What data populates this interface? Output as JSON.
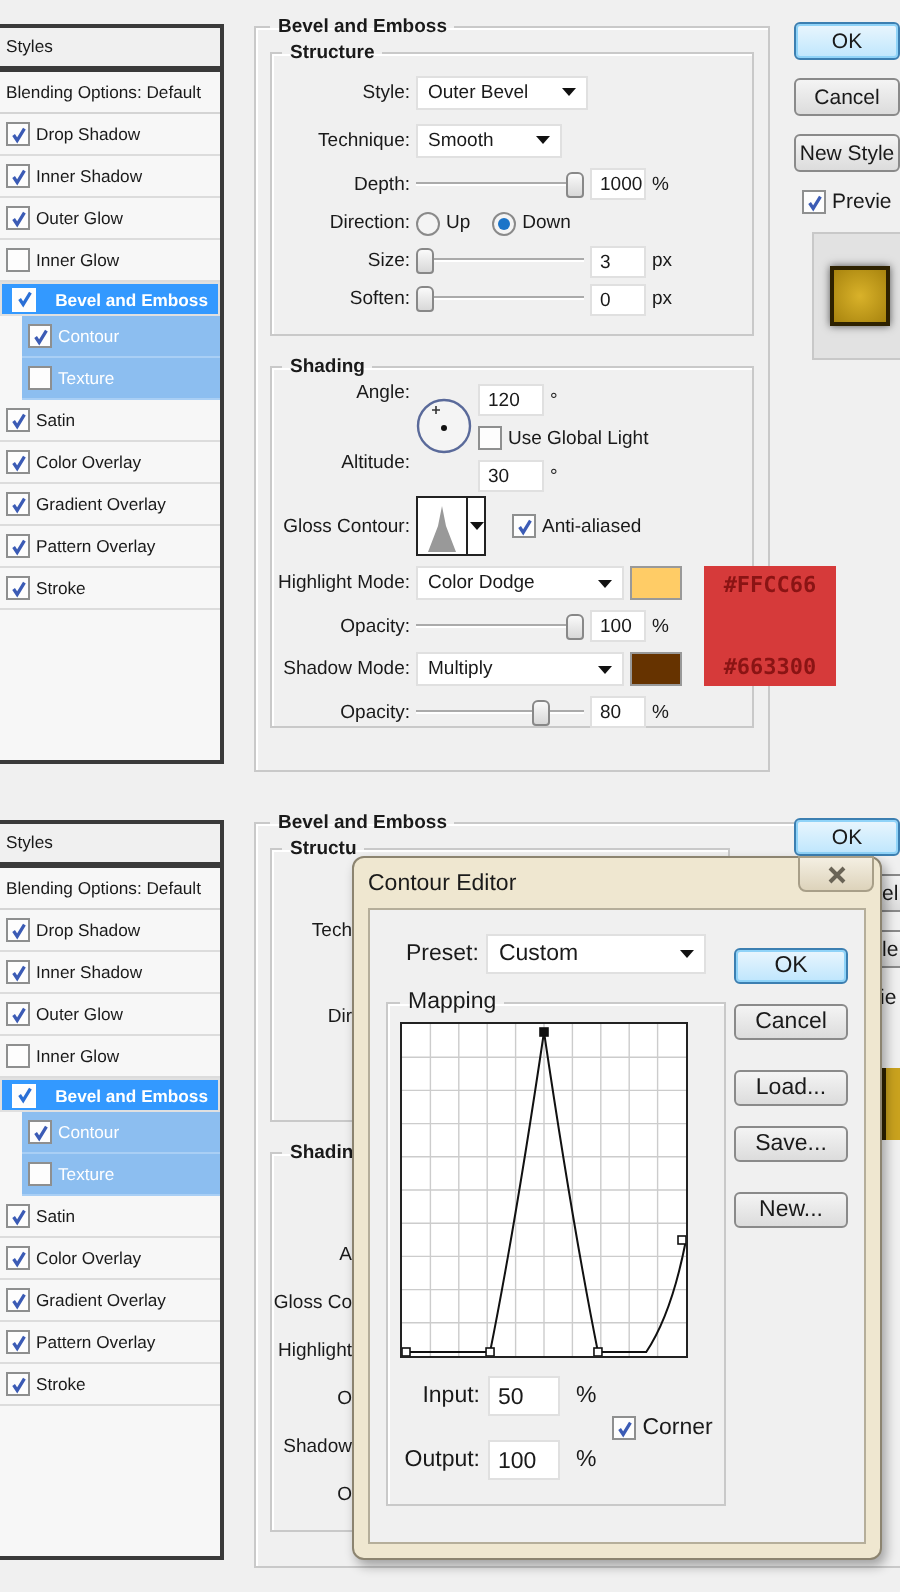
{
  "top_screen": {
    "styles_list": {
      "header": "Styles",
      "blending": "Blending Options: Default",
      "items": [
        {
          "label": "Drop Shadow",
          "kind": "main",
          "checked": true,
          "selected": false
        },
        {
          "label": "Inner Shadow",
          "kind": "main",
          "checked": true,
          "selected": false
        },
        {
          "label": "Outer Glow",
          "kind": "main",
          "checked": true,
          "selected": false
        },
        {
          "label": "Inner Glow",
          "kind": "main",
          "checked": false,
          "selected": false
        },
        {
          "label": "Bevel and Emboss",
          "kind": "main",
          "checked": true,
          "selected": true
        },
        {
          "label": "Contour",
          "kind": "sub",
          "checked": true,
          "selected": false
        },
        {
          "label": "Texture",
          "kind": "sub",
          "checked": false,
          "selected": false
        },
        {
          "label": "Satin",
          "kind": "main",
          "checked": true,
          "selected": false
        },
        {
          "label": "Color Overlay",
          "kind": "main",
          "checked": true,
          "selected": false
        },
        {
          "label": "Gradient Overlay",
          "kind": "main",
          "checked": true,
          "selected": false
        },
        {
          "label": "Pattern Overlay",
          "kind": "main",
          "checked": true,
          "selected": false
        },
        {
          "label": "Stroke",
          "kind": "main",
          "checked": true,
          "selected": false
        }
      ]
    },
    "settings": {
      "title": "Bevel and Emboss",
      "structure": {
        "title": "Structure",
        "style": {
          "label": "Style:",
          "value": "Outer Bevel"
        },
        "technique": {
          "label": "Technique:",
          "value": "Smooth"
        },
        "depth": {
          "label": "Depth:",
          "level": 1,
          "value": "1000",
          "unit": "%"
        },
        "direction": {
          "label": "Direction:",
          "options": [
            {
              "label": "Up",
              "selected": false
            },
            {
              "label": "Down",
              "selected": true
            }
          ]
        },
        "size": {
          "label": "Size:",
          "level": 0,
          "value": "3",
          "unit": "px"
        },
        "soften": {
          "label": "Soften:",
          "level": 0,
          "value": "0",
          "unit": "px"
        }
      },
      "shading": {
        "title": "Shading",
        "angle": {
          "label": "Angle:",
          "value": "120",
          "unit": "°"
        },
        "use_global_light": {
          "label": "Use Global Light",
          "checked": false
        },
        "altitude": {
          "label": "Altitude:",
          "value": "30",
          "unit": "°"
        },
        "gloss_contour": {
          "label": "Gloss Contour:"
        },
        "anti_aliased": {
          "label": "Anti-aliased",
          "checked": true
        },
        "highlight_mode": {
          "label": "Highlight Mode:",
          "value": "Color Dodge",
          "color": "#ffcc66"
        },
        "highlight_opacity": {
          "label": "Opacity:",
          "level": 1,
          "value": "100",
          "unit": "%"
        },
        "shadow_mode": {
          "label": "Shadow Mode:",
          "value": "Multiply",
          "color": "#663300"
        },
        "shadow_opacity": {
          "label": "Opacity:",
          "level": 0.77,
          "value": "80",
          "unit": "%"
        }
      },
      "annotation": [
        "#FFCC66",
        "#663300"
      ]
    },
    "buttons": [
      {
        "label": "OK",
        "default": true
      },
      {
        "label": "Cancel",
        "default": false
      },
      {
        "label": "New Style",
        "default": false
      }
    ],
    "preview": {
      "label": "Previe",
      "checked": true
    }
  },
  "bottom_screen": {
    "styles_list": {
      "header": "Styles",
      "blending": "Blending Options: Default",
      "items": [
        {
          "label": "Drop Shadow",
          "kind": "main",
          "checked": true,
          "selected": false
        },
        {
          "label": "Inner Shadow",
          "kind": "main",
          "checked": true,
          "selected": false
        },
        {
          "label": "Outer Glow",
          "kind": "main",
          "checked": true,
          "selected": false
        },
        {
          "label": "Inner Glow",
          "kind": "main",
          "checked": false,
          "selected": false
        },
        {
          "label": "Bevel and Emboss",
          "kind": "main",
          "checked": true,
          "selected": true
        },
        {
          "label": "Contour",
          "kind": "sub",
          "checked": true,
          "selected": false
        },
        {
          "label": "Texture",
          "kind": "sub",
          "checked": false,
          "selected": false
        },
        {
          "label": "Satin",
          "kind": "main",
          "checked": true,
          "selected": false
        },
        {
          "label": "Color Overlay",
          "kind": "main",
          "checked": true,
          "selected": false
        },
        {
          "label": "Gradient Overlay",
          "kind": "main",
          "checked": true,
          "selected": false
        },
        {
          "label": "Pattern Overlay",
          "kind": "main",
          "checked": true,
          "selected": false
        },
        {
          "label": "Stroke",
          "kind": "main",
          "checked": true,
          "selected": false
        }
      ]
    },
    "settings": {
      "title": "Bevel and Emboss",
      "structure": {
        "title": "Structu",
        "labels": [
          "Tech",
          "Dir"
        ]
      },
      "shading": {
        "title": "Shadin",
        "labels": [
          "A",
          "Gloss Co",
          "Highlight",
          "O",
          "Shadow",
          "O"
        ]
      }
    },
    "buttons": [
      {
        "label": "OK",
        "default": true
      },
      {
        "label": "el",
        "default": false
      },
      {
        "label": "le",
        "default": false
      }
    ],
    "preview_label": "ie",
    "contour_editor": {
      "title": "Contour Editor",
      "preset": {
        "label": "Preset:",
        "value": "Custom"
      },
      "mapping_title": "Mapping",
      "input": {
        "label": "Input:",
        "value": "50",
        "unit": "%"
      },
      "output": {
        "label": "Output:",
        "value": "100",
        "unit": "%"
      },
      "corner": {
        "label": "Corner",
        "checked": true
      },
      "buttons": [
        {
          "label": "OK",
          "default": true
        },
        {
          "label": "Cancel",
          "default": false
        },
        {
          "label": "Load...",
          "default": false
        },
        {
          "label": "Save...",
          "default": false
        },
        {
          "label": "New...",
          "default": false
        }
      ]
    }
  }
}
